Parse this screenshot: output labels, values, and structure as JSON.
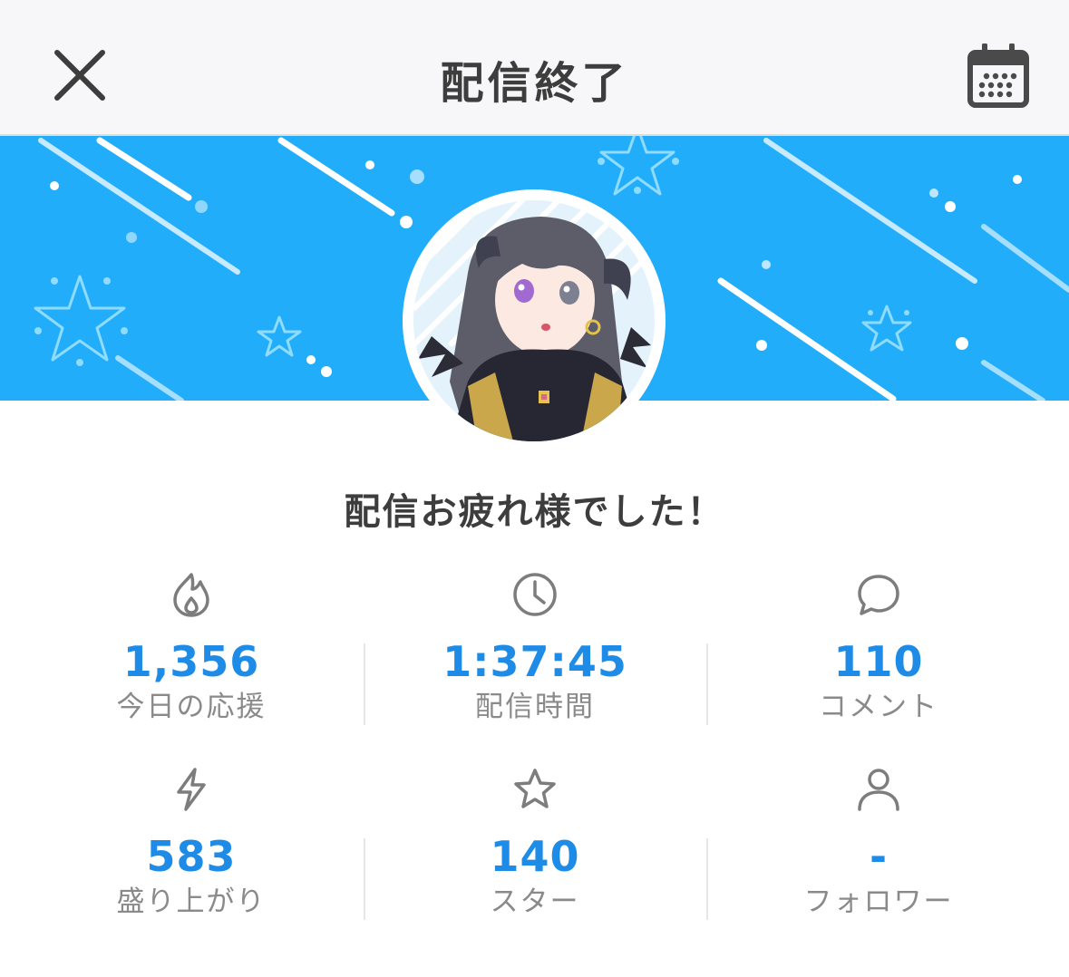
{
  "header": {
    "title": "配信終了"
  },
  "greeting": "配信お疲れ様でした！",
  "stats": [
    {
      "icon": "flame-icon",
      "value": "1,356",
      "label": "今日の応援"
    },
    {
      "icon": "clock-icon",
      "value": "1:37:45",
      "label": "配信時間"
    },
    {
      "icon": "comment-icon",
      "value": "110",
      "label": "コメント"
    },
    {
      "icon": "lightning-icon",
      "value": "583",
      "label": "盛り上がり"
    },
    {
      "icon": "star-icon",
      "value": "140",
      "label": "スター"
    },
    {
      "icon": "person-icon",
      "value": "-",
      "label": "フォロワー"
    }
  ],
  "colors": {
    "banner": "#22adfb",
    "value": "#1e8ce6",
    "label": "#8a8a8a",
    "header_bg": "#f7f7f9"
  }
}
